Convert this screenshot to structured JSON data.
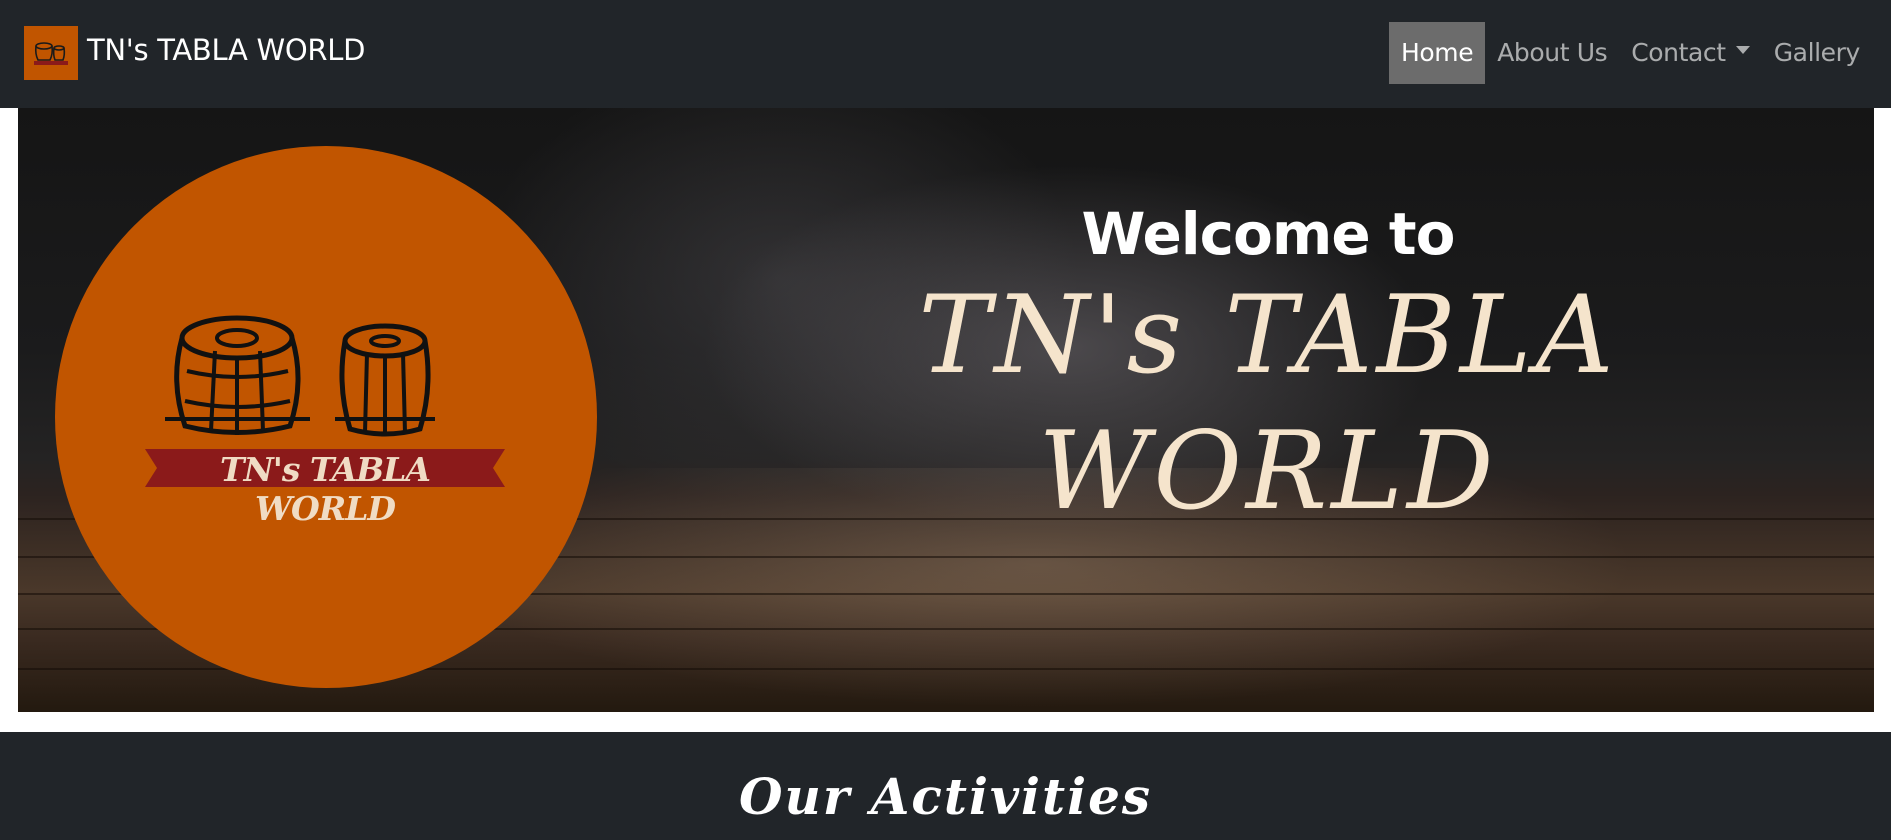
{
  "navbar": {
    "brand_text": "TN's TABLA WORLD",
    "brand_logo_icon": "tabla-logo-icon",
    "items": [
      {
        "label": "Home",
        "active": true
      },
      {
        "label": "About Us",
        "active": false
      },
      {
        "label": "Contact",
        "active": false,
        "dropdown": true
      },
      {
        "label": "Gallery",
        "active": false
      }
    ]
  },
  "hero": {
    "welcome": "Welcome to",
    "title_line1": "TN's TABLA",
    "title_line2": "WORLD",
    "logo_banner_text": "TN's TABLA WORLD"
  },
  "activities": {
    "title": "Our Activities"
  },
  "colors": {
    "navbar_bg": "#212529",
    "brand_orange": "#c15500",
    "active_nav_bg": "#6c6c6c",
    "banner_red": "#8b1a1a",
    "title_cream": "#f5e4cc"
  }
}
